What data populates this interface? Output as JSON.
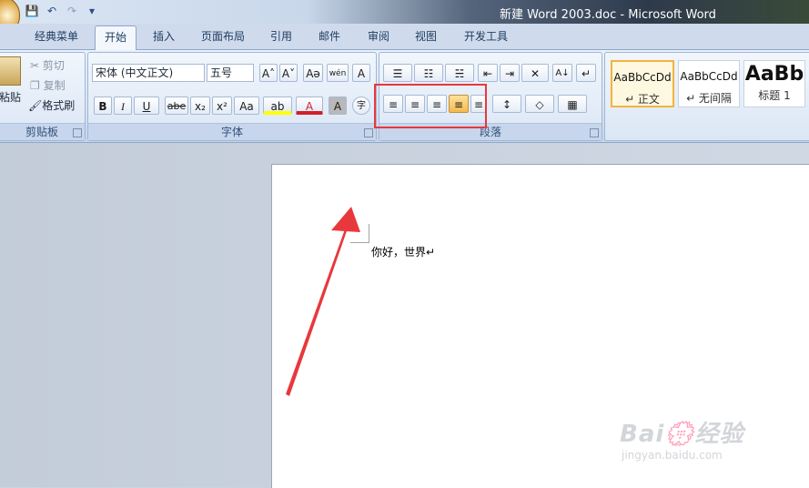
{
  "window": {
    "title": "新建 Word 2003.doc - Microsoft Word"
  },
  "quick_access": {
    "save": "💾",
    "undo": "↶",
    "redo": "↷",
    "more": "▾"
  },
  "tabs": [
    "经典菜单",
    "开始",
    "插入",
    "页面布局",
    "引用",
    "邮件",
    "审阅",
    "视图",
    "开发工具"
  ],
  "active_tab": "开始",
  "clipboard": {
    "paste": "粘贴",
    "cut": "剪切",
    "copy": "复制",
    "format_painter": "格式刷",
    "group_label": "剪贴板"
  },
  "font": {
    "font_name": "宋体 (中文正文)",
    "font_size": "五号",
    "group_label": "字体",
    "grow": "A˄",
    "shrink": "A˅",
    "clear": "Aə",
    "phonetic": "wén",
    "border_char": "A",
    "bold": "B",
    "italic": "I",
    "underline": "U",
    "strike": "abe",
    "subscript": "x₂",
    "superscript": "x²",
    "case": "Aa",
    "highlight": "ab",
    "font_color": "A",
    "shade": "A",
    "enclose": "字"
  },
  "paragraph": {
    "group_label": "段落",
    "bullets": "☰",
    "numbering": "☷",
    "multilevel": "☵",
    "decrease_indent": "⇤",
    "increase_indent": "⇥",
    "chinese_layout": "✕",
    "sort": "A↓",
    "show_marks": "↵",
    "align_left": "≡",
    "align_center": "≡",
    "align_right": "≡",
    "justify": "≡",
    "distributed": "≡",
    "line_spacing": "↕",
    "shading": "◇",
    "borders": "▦"
  },
  "styles": {
    "items": [
      {
        "preview": "AaBbCcDd",
        "name": "↵ 正文"
      },
      {
        "preview": "AaBbCcDd",
        "name": "↵ 无间隔"
      },
      {
        "preview": "AaBb",
        "name": "标题 1"
      }
    ]
  },
  "document": {
    "text": "你好，世界↵"
  },
  "watermark": {
    "brand": "Bai💮经验",
    "url": "jingyan.baidu.com"
  },
  "colors": {
    "highlight": "#e8383d",
    "arrow": "#e8383d",
    "font_color_bar": "#d0202a",
    "highlight_bar": "#ffff00"
  }
}
